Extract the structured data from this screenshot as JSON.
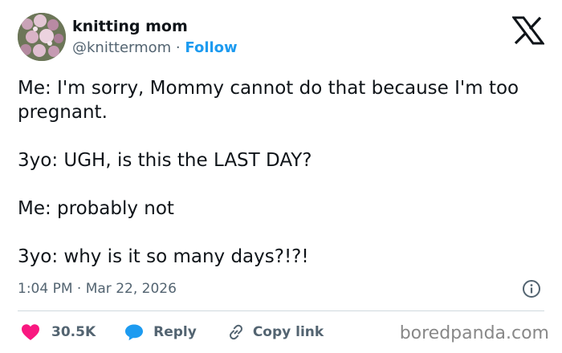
{
  "author": {
    "name": "knitting mom",
    "handle": "@knittermom",
    "separator": "·",
    "follow_label": "Follow"
  },
  "tweet": {
    "lines": [
      "Me: I'm sorry, Mommy cannot do that because I'm too pregnant.",
      "3yo: UGH, is this the LAST DAY?",
      "Me: probably not",
      "3yo: why is it so many days?!?!"
    ],
    "timestamp": "1:04 PM · Mar 22, 2026"
  },
  "actions": {
    "like_count": "30.5K",
    "reply_label": "Reply",
    "copy_label": "Copy link"
  },
  "icons": {
    "logo": "x-logo-icon",
    "info": "info-icon",
    "like": "heart-icon",
    "reply": "speech-bubble-icon",
    "copy": "link-icon"
  },
  "colors": {
    "like": "#f91880",
    "reply": "#1d9bf0",
    "follow": "#1d9bf0",
    "muted_text": "#536471"
  },
  "watermark": "boredpanda.com"
}
